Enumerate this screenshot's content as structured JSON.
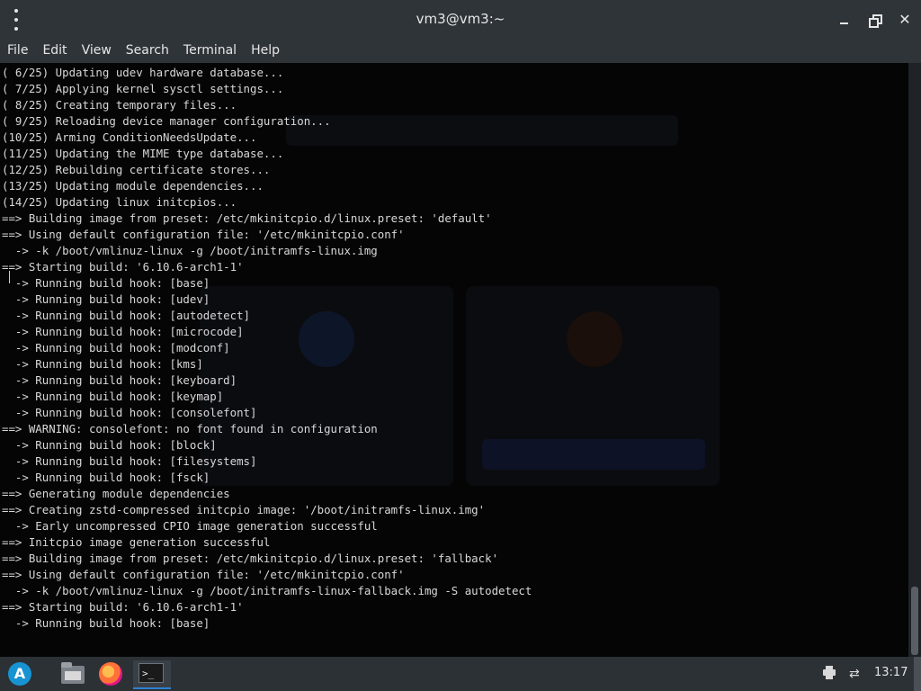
{
  "window": {
    "title": "vm3@vm3:~",
    "close_glyph": "✕"
  },
  "menubar": {
    "items": [
      "File",
      "Edit",
      "View",
      "Search",
      "Terminal",
      "Help"
    ]
  },
  "terminal": {
    "lines": [
      "( 6/25) Updating udev hardware database...",
      "( 7/25) Applying kernel sysctl settings...",
      "( 8/25) Creating temporary files...",
      "( 9/25) Reloading device manager configuration...",
      "(10/25) Arming ConditionNeedsUpdate...",
      "(11/25) Updating the MIME type database...",
      "(12/25) Rebuilding certificate stores...",
      "(13/25) Updating module dependencies...",
      "(14/25) Updating linux initcpios...",
      "==> Building image from preset: /etc/mkinitcpio.d/linux.preset: 'default'",
      "==> Using default configuration file: '/etc/mkinitcpio.conf'",
      "  -> -k /boot/vmlinuz-linux -g /boot/initramfs-linux.img",
      "==> Starting build: '6.10.6-arch1-1'",
      "  -> Running build hook: [base]",
      "  -> Running build hook: [udev]",
      "  -> Running build hook: [autodetect]",
      "  -> Running build hook: [microcode]",
      "  -> Running build hook: [modconf]",
      "  -> Running build hook: [kms]",
      "  -> Running build hook: [keyboard]",
      "  -> Running build hook: [keymap]",
      "  -> Running build hook: [consolefont]",
      "==> WARNING: consolefont: no font found in configuration",
      "  -> Running build hook: [block]",
      "  -> Running build hook: [filesystems]",
      "  -> Running build hook: [fsck]",
      "==> Generating module dependencies",
      "==> Creating zstd-compressed initcpio image: '/boot/initramfs-linux.img'",
      "  -> Early uncompressed CPIO image generation successful",
      "==> Initcpio image generation successful",
      "==> Building image from preset: /etc/mkinitcpio.d/linux.preset: 'fallback'",
      "==> Using default configuration file: '/etc/mkinitcpio.conf'",
      "  -> -k /boot/vmlinuz-linux -g /boot/initramfs-linux-fallback.img -S autodetect",
      "==> Starting build: '6.10.6-arch1-1'",
      "  -> Running build hook: [base]"
    ]
  },
  "taskbar": {
    "launcher_icon": "arch-linux-logo",
    "apps": [
      {
        "name": "file-manager-icon"
      },
      {
        "name": "firefox-icon"
      },
      {
        "name": "terminal-icon",
        "glyph": ">_"
      }
    ],
    "tray": [
      "printer-icon",
      "network-icon"
    ],
    "clock": "13:17"
  },
  "colors": {
    "chrome": "#2f3439",
    "terminal_bg": "#050505",
    "terminal_fg": "#d8d8d8",
    "accent": "#2c81d0"
  }
}
